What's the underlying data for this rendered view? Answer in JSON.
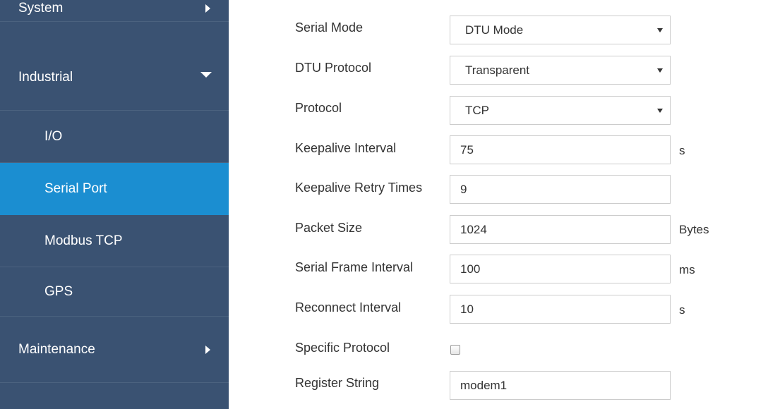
{
  "sidebar": {
    "items": [
      {
        "label": "System"
      },
      {
        "label": "Industrial"
      },
      {
        "label": "I/O"
      },
      {
        "label": "Serial Port"
      },
      {
        "label": "Modbus TCP"
      },
      {
        "label": "GPS"
      },
      {
        "label": "Maintenance"
      }
    ]
  },
  "form": {
    "serial_mode": {
      "label": "Serial Mode",
      "value": "DTU Mode"
    },
    "dtu_protocol": {
      "label": "DTU Protocol",
      "value": "Transparent"
    },
    "protocol": {
      "label": "Protocol",
      "value": "TCP"
    },
    "keepalive_interval": {
      "label": "Keepalive Interval",
      "value": "75",
      "unit": "s"
    },
    "keepalive_retry": {
      "label": "Keepalive Retry Times",
      "value": "9"
    },
    "packet_size": {
      "label": "Packet Size",
      "value": "1024",
      "unit": "Bytes"
    },
    "serial_frame_interval": {
      "label": "Serial Frame Interval",
      "value": "100",
      "unit": "ms"
    },
    "reconnect_interval": {
      "label": "Reconnect Interval",
      "value": "10",
      "unit": "s"
    },
    "specific_protocol": {
      "label": "Specific Protocol",
      "checked": false
    },
    "register_string": {
      "label": "Register String",
      "value": "modem1"
    }
  }
}
